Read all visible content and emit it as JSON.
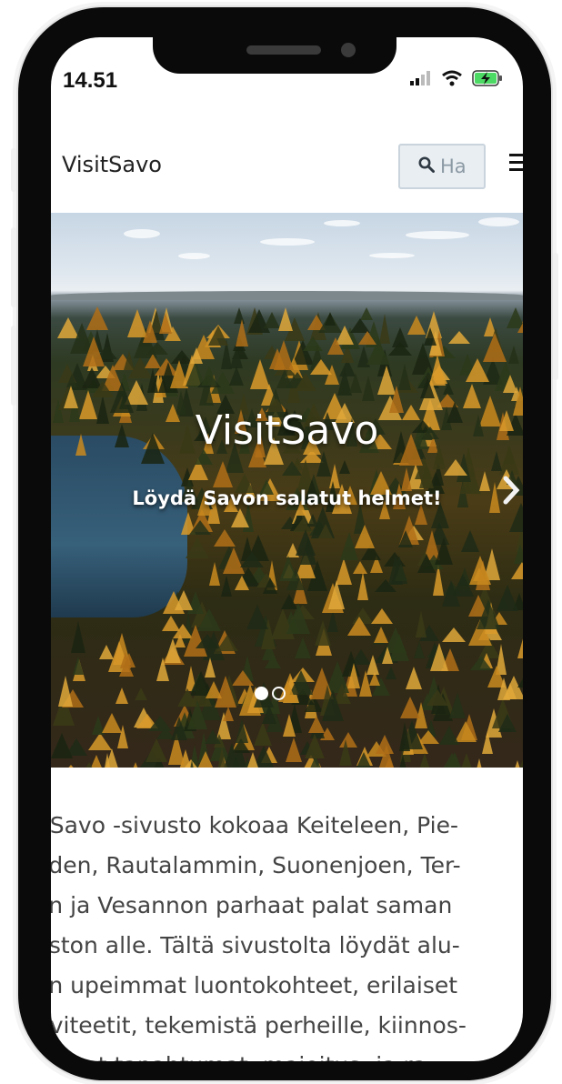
{
  "status_bar": {
    "time": "14.51",
    "icons": [
      "signal-icon",
      "wifi-icon",
      "battery-charging-icon"
    ]
  },
  "navbar": {
    "brand": "VisitSavo",
    "search_placeholder": "Ha",
    "icons": [
      "search-icon",
      "menu-icon"
    ]
  },
  "hero": {
    "title": "VisitSavo",
    "subtitle": "Löydä Savon salatut helmet!",
    "slides_total": 2,
    "active_slide": 1
  },
  "intro": {
    "lines": [
      "itSavo -sivusto kokoaa Keiteleen, Pie-",
      "eden, Rautalammin, Suonenjoen, Ter-",
      "on ja Vesannon parhaat palat saman",
      "uston alle. Tältä sivustolta löydät alu-",
      "en upeimmat luontokohteet, erilaiset",
      "tiviteetit, tekemistä perheille, kiinnos-",
      "vamat tapahtumat, majoitus- ja ra-"
    ]
  },
  "colors": {
    "frame": "#0a0a0a",
    "search_bg": "#e9eef2",
    "search_border": "#c9d4dd",
    "text": "#444444",
    "battery": "#4cd964"
  }
}
